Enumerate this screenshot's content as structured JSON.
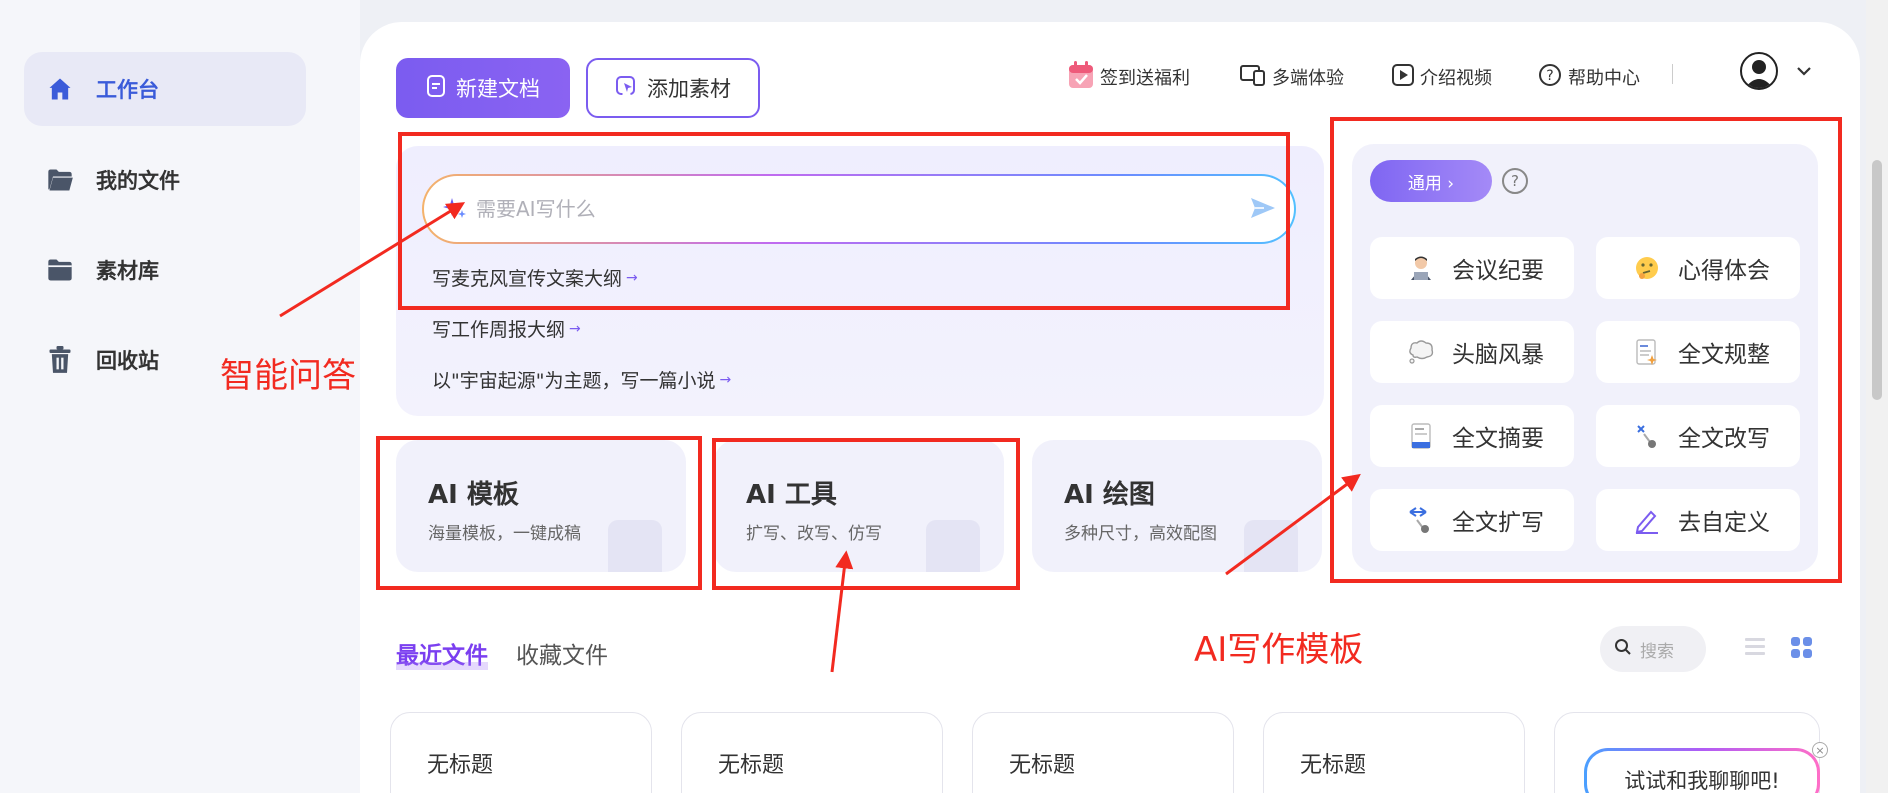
{
  "sidebar": {
    "items": [
      {
        "label": "工作台",
        "icon": "home-icon",
        "active": true
      },
      {
        "label": "我的文件",
        "icon": "folder-open-icon"
      },
      {
        "label": "素材库",
        "icon": "folder-icon"
      },
      {
        "label": "回收站",
        "icon": "trash-icon"
      }
    ]
  },
  "toolbar": {
    "new_doc": "新建文档",
    "add_material": "添加素材"
  },
  "topbar": {
    "checkin": "签到送福利",
    "multi_device": "多端体验",
    "intro_video": "介绍视频",
    "help_center": "帮助中心"
  },
  "chat": {
    "placeholder": "需要AI写什么",
    "suggestions": [
      "写麦克风宣传文案大纲",
      "写工作周报大纲",
      "以\"宇宙起源\"为主题，写一篇小说"
    ]
  },
  "ai_cards": [
    {
      "title": "AI 模板",
      "subtitle": "海量模板，一键成稿"
    },
    {
      "title": "AI 工具",
      "subtitle": "扩写、改写、仿写"
    },
    {
      "title": "AI 绘图",
      "subtitle": "多种尺寸，高效配图"
    }
  ],
  "templates": {
    "tag": "通用 ›",
    "help": "?",
    "items": [
      {
        "label": "会议纪要",
        "icon": "person-laptop-icon"
      },
      {
        "label": "心得体会",
        "icon": "thinking-face-icon"
      },
      {
        "label": "头脑风暴",
        "icon": "thought-bubble-icon"
      },
      {
        "label": "全文规整",
        "icon": "document-sparkle-icon"
      },
      {
        "label": "全文摘要",
        "icon": "document-summary-icon"
      },
      {
        "label": "全文改写",
        "icon": "rewrite-icon"
      },
      {
        "label": "全文扩写",
        "icon": "expand-icon"
      },
      {
        "label": "去自定义",
        "icon": "pencil-icon"
      }
    ]
  },
  "recent": {
    "tab_recent": "最近文件",
    "tab_fav": "收藏文件",
    "search_placeholder": "搜索",
    "files": [
      "无标题",
      "无标题",
      "无标题",
      "无标题"
    ]
  },
  "chat_bubble": {
    "text": "试试和我聊聊吧!",
    "close": "×"
  },
  "annotations": {
    "smart_qa": "智能问答",
    "ai_template": "AI写作模板",
    "color": "#f22a20"
  },
  "colors": {
    "primary": "#7b5cf0",
    "active_nav": "#3a5bd9",
    "annotation": "#f22a20"
  }
}
